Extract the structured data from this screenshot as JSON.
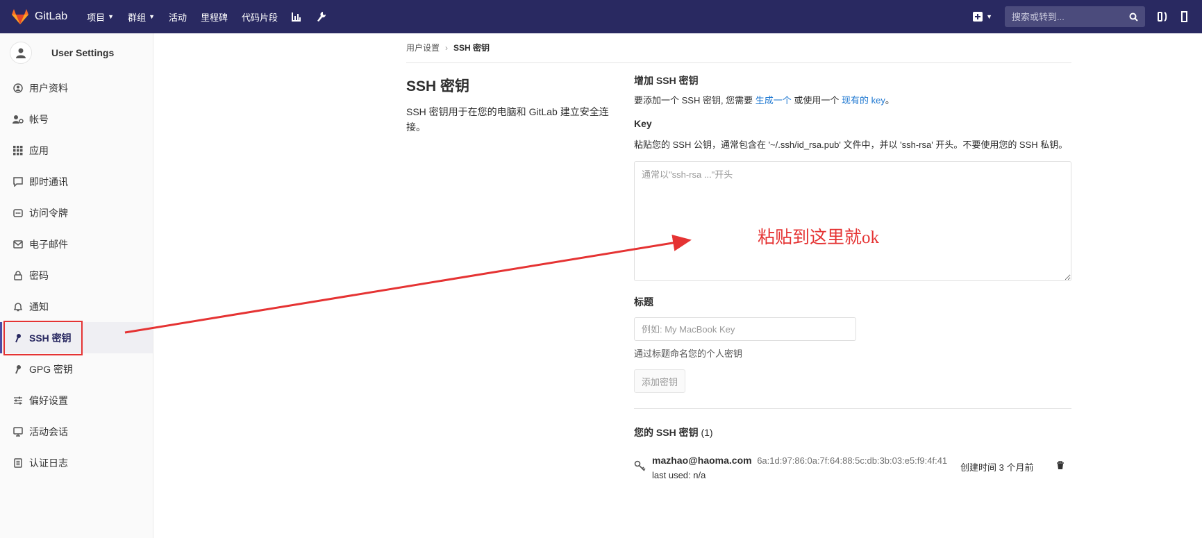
{
  "topbar": {
    "brand": "GitLab",
    "nav": [
      {
        "label": "项目",
        "dropdown": true
      },
      {
        "label": "群组",
        "dropdown": true
      },
      {
        "label": "活动",
        "dropdown": false
      },
      {
        "label": "里程碑",
        "dropdown": false
      },
      {
        "label": "代码片段",
        "dropdown": false
      }
    ],
    "search_placeholder": "搜索或转到..."
  },
  "sidebar": {
    "title": "User Settings",
    "items": [
      {
        "label": "用户资料",
        "icon": "profile-icon"
      },
      {
        "label": "帐号",
        "icon": "account-icon"
      },
      {
        "label": "应用",
        "icon": "applications-icon"
      },
      {
        "label": "即时通讯",
        "icon": "chat-icon"
      },
      {
        "label": "访问令牌",
        "icon": "token-icon"
      },
      {
        "label": "电子邮件",
        "icon": "email-icon"
      },
      {
        "label": "密码",
        "icon": "lock-icon"
      },
      {
        "label": "通知",
        "icon": "bell-icon"
      },
      {
        "label": "SSH 密钥",
        "icon": "key-icon",
        "active": true
      },
      {
        "label": "GPG 密钥",
        "icon": "key-icon"
      },
      {
        "label": "偏好设置",
        "icon": "sliders-icon"
      },
      {
        "label": "活动会话",
        "icon": "monitor-icon"
      },
      {
        "label": "认证日志",
        "icon": "log-icon"
      }
    ]
  },
  "breadcrumb": {
    "parent": "用户设置",
    "current": "SSH 密钥"
  },
  "intro": {
    "title": "SSH 密钥",
    "text": "SSH 密钥用于在您的电脑和 GitLab 建立安全连接。"
  },
  "form": {
    "heading": "增加 SSH 密钥",
    "desc_prefix": "要添加一个 SSH 密钥, 您需要 ",
    "generate_link": "生成一个",
    "desc_middle": " 或使用一个 ",
    "existing_link": "现有的 key",
    "desc_suffix": "。",
    "key_label": "Key",
    "key_help": "粘贴您的 SSH 公钥，通常包含在 '~/.ssh/id_rsa.pub' 文件中，并以 'ssh-rsa' 开头。不要使用您的 SSH 私钥。",
    "key_placeholder": "通常以\"ssh-rsa ...\"开头",
    "title_label": "标题",
    "title_placeholder": "例如: My MacBook Key",
    "title_help": "通过标题命名您的个人密钥",
    "add_button": "添加密钥"
  },
  "annotation": "粘贴到这里就ok",
  "keys": {
    "title": "您的 SSH 密钥",
    "count": "(1)",
    "items": [
      {
        "name": "mazhao@haoma.com",
        "fingerprint": "6a:1d:97:86:0a:7f:64:88:5c:db:3b:03:e5:f9:4f:41",
        "last_used": "last used: n/a",
        "created": "创建时间 3 个月前"
      }
    ]
  },
  "colors": {
    "nav_bg": "#292961",
    "annotation": "#e53333",
    "link": "#1f78d1"
  }
}
